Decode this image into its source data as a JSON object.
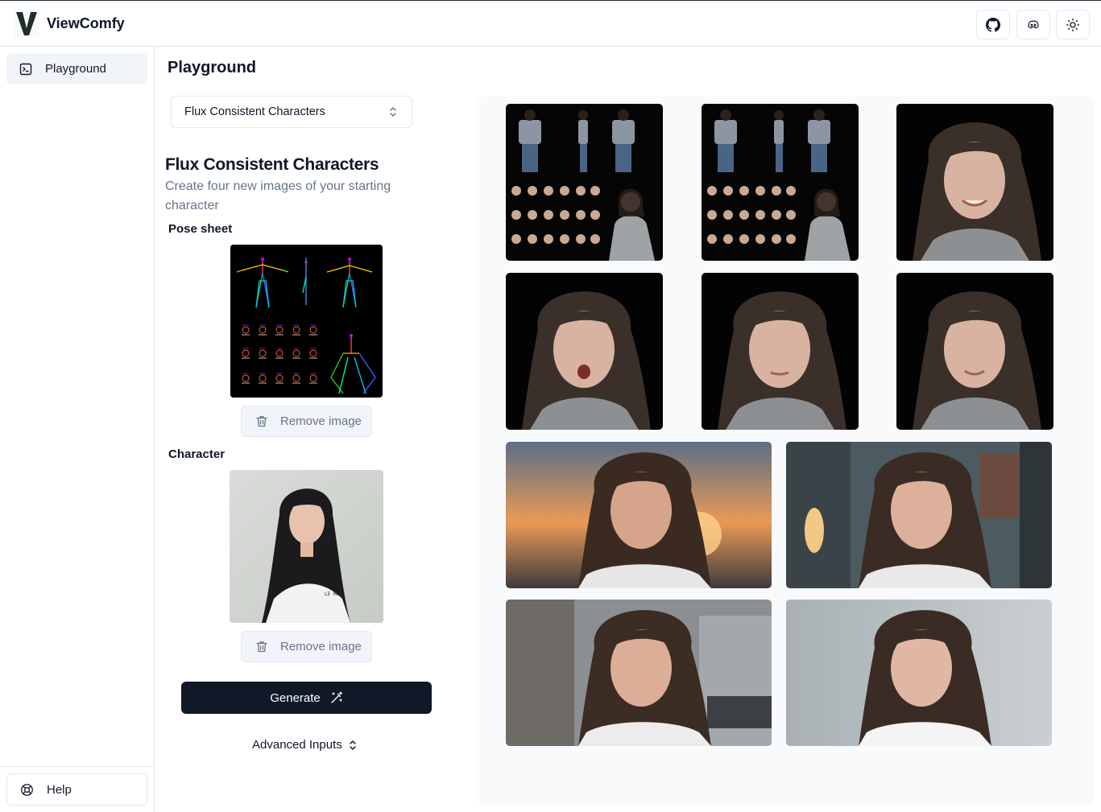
{
  "app": {
    "name": "ViewComfy"
  },
  "header": {
    "buttons": [
      {
        "name": "github-icon"
      },
      {
        "name": "discord-icon"
      },
      {
        "name": "sun-icon"
      }
    ]
  },
  "sidebar": {
    "items": [
      {
        "label": "Playground",
        "icon": "terminal-icon"
      }
    ],
    "help_label": "Help"
  },
  "main": {
    "title": "Playground",
    "workflow_select": {
      "value": "Flux Consistent Characters"
    },
    "workflow": {
      "title": "Flux Consistent Characters",
      "description": "Create four new images of your starting character"
    },
    "inputs": [
      {
        "label": "Pose sheet",
        "remove_label": "Remove image"
      },
      {
        "label": "Character",
        "remove_label": "Remove image",
        "shirt_text": "LE MODE"
      }
    ],
    "generate_label": "Generate",
    "advanced_label": "Advanced Inputs"
  },
  "gallery": {
    "images": [
      {
        "name": "pose-sheet-output-1",
        "kind": "sheet"
      },
      {
        "name": "pose-sheet-output-2",
        "kind": "sheet"
      },
      {
        "name": "portrait-smile",
        "kind": "dark-portrait"
      },
      {
        "name": "portrait-surprised",
        "kind": "dark-portrait"
      },
      {
        "name": "portrait-neutral",
        "kind": "dark-portrait"
      },
      {
        "name": "portrait-soft-smile",
        "kind": "dark-portrait"
      },
      {
        "name": "portrait-sunset",
        "kind": "sunset"
      },
      {
        "name": "portrait-indoor",
        "kind": "indoor"
      },
      {
        "name": "portrait-street",
        "kind": "street"
      },
      {
        "name": "portrait-studio",
        "kind": "studio"
      }
    ]
  },
  "colors": {
    "primary": "#111827",
    "muted_text": "#64748b",
    "border": "#e2e8f0",
    "sidebar_active": "#f1f5f9",
    "gallery_bg": "#f8fafc"
  }
}
